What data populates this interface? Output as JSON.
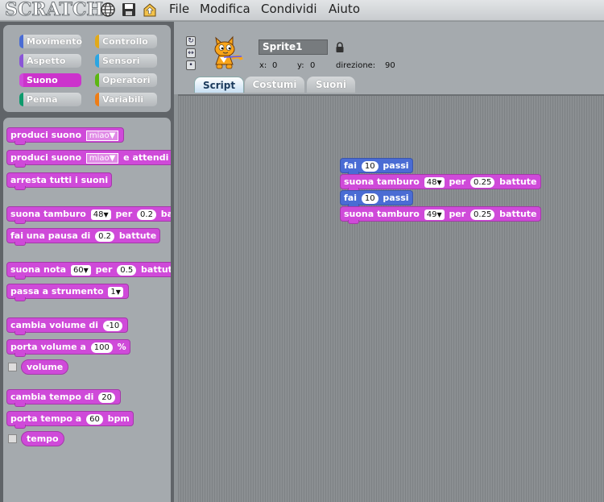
{
  "app": {
    "logo": "SCRATCH"
  },
  "menu": [
    "File",
    "Modifica",
    "Condividi",
    "Aiuto"
  ],
  "toolbar_icons": [
    "globe-icon",
    "save-icon",
    "share-icon"
  ],
  "categories": [
    {
      "label": "Movimento",
      "color": "#4a6cd4"
    },
    {
      "label": "Controllo",
      "color": "#e1a91a"
    },
    {
      "label": "Aspetto",
      "color": "#8a55d7"
    },
    {
      "label": "Sensori",
      "color": "#2ca5e2"
    },
    {
      "label": "Suono",
      "color": "#cf4ad9",
      "selected": true
    },
    {
      "label": "Operatori",
      "color": "#5cb712"
    },
    {
      "label": "Penna",
      "color": "#0e9a6c"
    },
    {
      "label": "Variabili",
      "color": "#ee7d16"
    }
  ],
  "palette": {
    "b1": {
      "text": "produci suono",
      "menu": "miao"
    },
    "b2": {
      "text": "produci suono",
      "menu": "miao",
      "suffix": "e attendi la"
    },
    "b3": {
      "text": "arresta tutti i suoni"
    },
    "b4": {
      "text": "suona tamburo",
      "value": "48",
      "mid": "per",
      "value2": "0.2",
      "suffix": "batt"
    },
    "b5": {
      "text": "fai una pausa di",
      "value": "0.2",
      "suffix": "battute"
    },
    "b6": {
      "text": "suona nota",
      "value": "60",
      "mid": "per",
      "value2": "0.5",
      "suffix": "battute"
    },
    "b7": {
      "text": "passa a strumento",
      "value": "1"
    },
    "b8": {
      "text": "cambia volume di",
      "value": "-10"
    },
    "b9": {
      "text": "porta volume a",
      "value": "100",
      "suffix": "%"
    },
    "r1": {
      "text": "volume"
    },
    "b10": {
      "text": "cambia tempo di",
      "value": "20"
    },
    "b11": {
      "text": "porta tempo a",
      "value": "60",
      "suffix": "bpm"
    },
    "r2": {
      "text": "tempo"
    }
  },
  "sprite": {
    "name": "Sprite1",
    "x_label": "x:",
    "x": "0",
    "y_label": "y:",
    "y": "0",
    "dir_label": "direzione:",
    "dir": "90"
  },
  "tabs": [
    "Script",
    "Costumi",
    "Suoni"
  ],
  "script": {
    "s1": {
      "text": "fai",
      "value": "10",
      "suffix": "passi"
    },
    "s2": {
      "text": "suona tamburo",
      "value": "48",
      "mid": "per",
      "value2": "0.25",
      "suffix": "battute"
    },
    "s3": {
      "text": "fai",
      "value": "10",
      "suffix": "passi"
    },
    "s4": {
      "text": "suona tamburo",
      "value": "49",
      "mid": "per",
      "value2": "0.25",
      "suffix": "battute"
    }
  }
}
